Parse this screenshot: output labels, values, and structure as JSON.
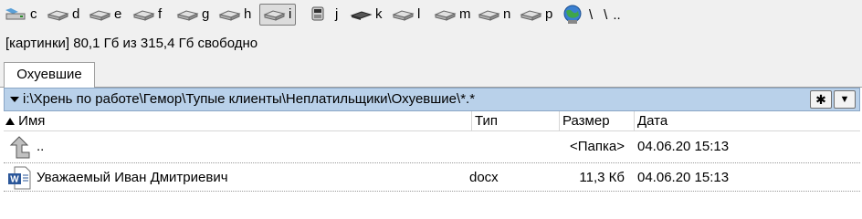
{
  "drives": [
    {
      "letter": "c",
      "icon": "drive-icon"
    },
    {
      "letter": "d",
      "icon": "drive-icon"
    },
    {
      "letter": "e",
      "icon": "drive-icon"
    },
    {
      "letter": "f",
      "icon": "drive-icon"
    },
    {
      "letter": "g",
      "icon": "drive-icon"
    },
    {
      "letter": "h",
      "icon": "drive-icon"
    },
    {
      "letter": "i",
      "icon": "drive-icon"
    },
    {
      "letter": "j",
      "icon": "usb-drive-icon"
    },
    {
      "letter": "k",
      "icon": "drive-icon"
    },
    {
      "letter": "l",
      "icon": "drive-icon"
    },
    {
      "letter": "m",
      "icon": "drive-icon"
    },
    {
      "letter": "n",
      "icon": "drive-icon"
    },
    {
      "letter": "p",
      "icon": "drive-icon"
    }
  ],
  "nav": {
    "root": "\\",
    "parent": ".."
  },
  "status": {
    "text": "[картинки]  80,1 Гб из 315,4 Гб свободно"
  },
  "tabs": [
    {
      "label": "Охуевшие"
    }
  ],
  "path": {
    "text": "i:\\Хрень по работе\\Гемор\\Тупые клиенты\\Неплатильщики\\Охуевшие\\*.*",
    "star": "✱",
    "dropdown": "▼"
  },
  "columns": {
    "name": "Имя",
    "type": "Тип",
    "size": "Размер",
    "date": "Дата"
  },
  "rows": [
    {
      "name": "..",
      "type": "",
      "size": "<Папка>",
      "date": "04.06.20 15:13"
    },
    {
      "name": "Уважаемый Иван Дмитриевич",
      "type": "docx",
      "size": "11,3 Кб",
      "date": "04.06.20 15:13"
    }
  ]
}
